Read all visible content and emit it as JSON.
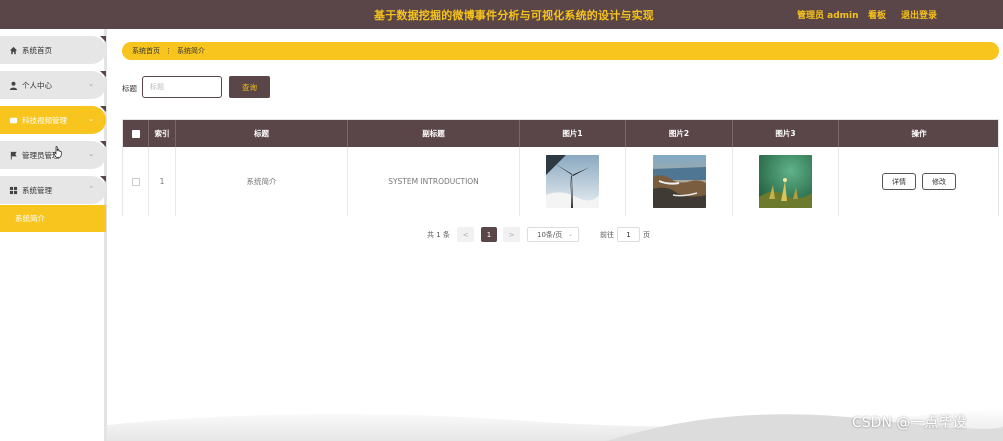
{
  "header": {
    "title": "基于数据挖掘的微博事件分析与可视化系统的设计与实现",
    "admin": "管理员 admin",
    "board": "看板",
    "logout": "退出登录"
  },
  "sidebar": {
    "items": [
      {
        "label": "系统首页",
        "icon": "home-icon"
      },
      {
        "label": "个人中心",
        "icon": "user-icon"
      },
      {
        "label": "科技视频管理",
        "icon": "video-icon"
      },
      {
        "label": "管理员管理",
        "icon": "flag-icon"
      },
      {
        "label": "系统管理",
        "icon": "grid-icon"
      }
    ],
    "submenu": "系统简介"
  },
  "breadcrumb": {
    "home": "系统首页",
    "separator": "⋮",
    "current": "系统简介"
  },
  "search": {
    "label": "标题",
    "placeholder": "标题",
    "button": "查询"
  },
  "table": {
    "columns": [
      "索引",
      "标题",
      "副标题",
      "图片1",
      "图片2",
      "图片3",
      "操作"
    ],
    "rows": [
      {
        "index": "1",
        "title": "系统简介",
        "subtitle": "SYSTEM INTRODUCTION",
        "images": [
          "wind-turbine-image",
          "coastal-rocks-image",
          "green-plant-image"
        ],
        "detail": "详情",
        "edit": "修改"
      }
    ]
  },
  "pagination": {
    "total": "共 1 条",
    "prev": "<",
    "page": "1",
    "next": ">",
    "size": "10条/页",
    "goto": "前往",
    "goto_value": "1",
    "page_suffix": "页"
  },
  "watermark": "CSDN @一点毕设",
  "colors": {
    "brand": "#5a4548",
    "accent": "#f8c51e",
    "accent_text": "#f5c21a"
  }
}
